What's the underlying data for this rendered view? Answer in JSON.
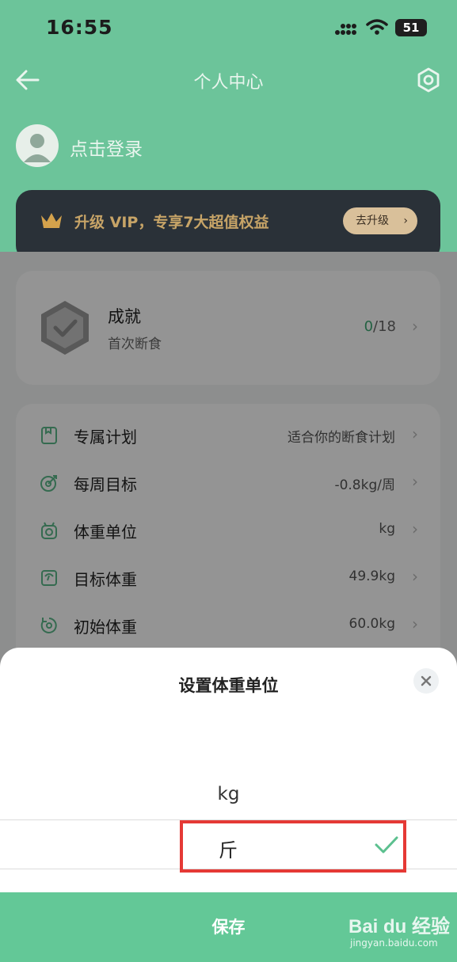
{
  "status_bar": {
    "time": "16:55",
    "battery": "51"
  },
  "nav": {
    "title": "个人中心",
    "back_icon": "back-arrow-icon",
    "settings_icon": "gear-icon"
  },
  "profile": {
    "login_text": "点击登录",
    "avatar_icon": "user-avatar-icon"
  },
  "vip": {
    "text": "升级 VIP，专享7大超值权益",
    "button": "去升级",
    "button_arrow": "›",
    "crown_color": "#d4a24c"
  },
  "achievement": {
    "title": "成就",
    "subtitle": "首次断食",
    "count_done": "0",
    "count_total": "/18",
    "chevron": "›"
  },
  "settings_list": [
    {
      "icon": "plan-icon",
      "label": "专属计划",
      "value": "适合你的断食计划",
      "chevron": "›"
    },
    {
      "icon": "target-icon",
      "label": "每周目标",
      "value": "-0.8kg/周",
      "chevron": "›"
    },
    {
      "icon": "scale-icon",
      "label": "体重单位",
      "value": "kg",
      "chevron": "›"
    },
    {
      "icon": "goal-weight-icon",
      "label": "目标体重",
      "value": "49.9kg",
      "chevron": "›"
    },
    {
      "icon": "initial-weight-icon",
      "label": "初始体重",
      "value": "60.0kg",
      "chevron": "›"
    }
  ],
  "sheet": {
    "title": "设置体重单位",
    "options": [
      "kg",
      "斤"
    ],
    "selected": "斤",
    "save_label": "保存"
  },
  "watermark": {
    "logo": "Bai du 经验",
    "url": "jingyan.baidu.com"
  },
  "colors": {
    "primary_green": "#63c897",
    "highlight_red": "#e53935",
    "vip_gold": "#c7a467"
  }
}
